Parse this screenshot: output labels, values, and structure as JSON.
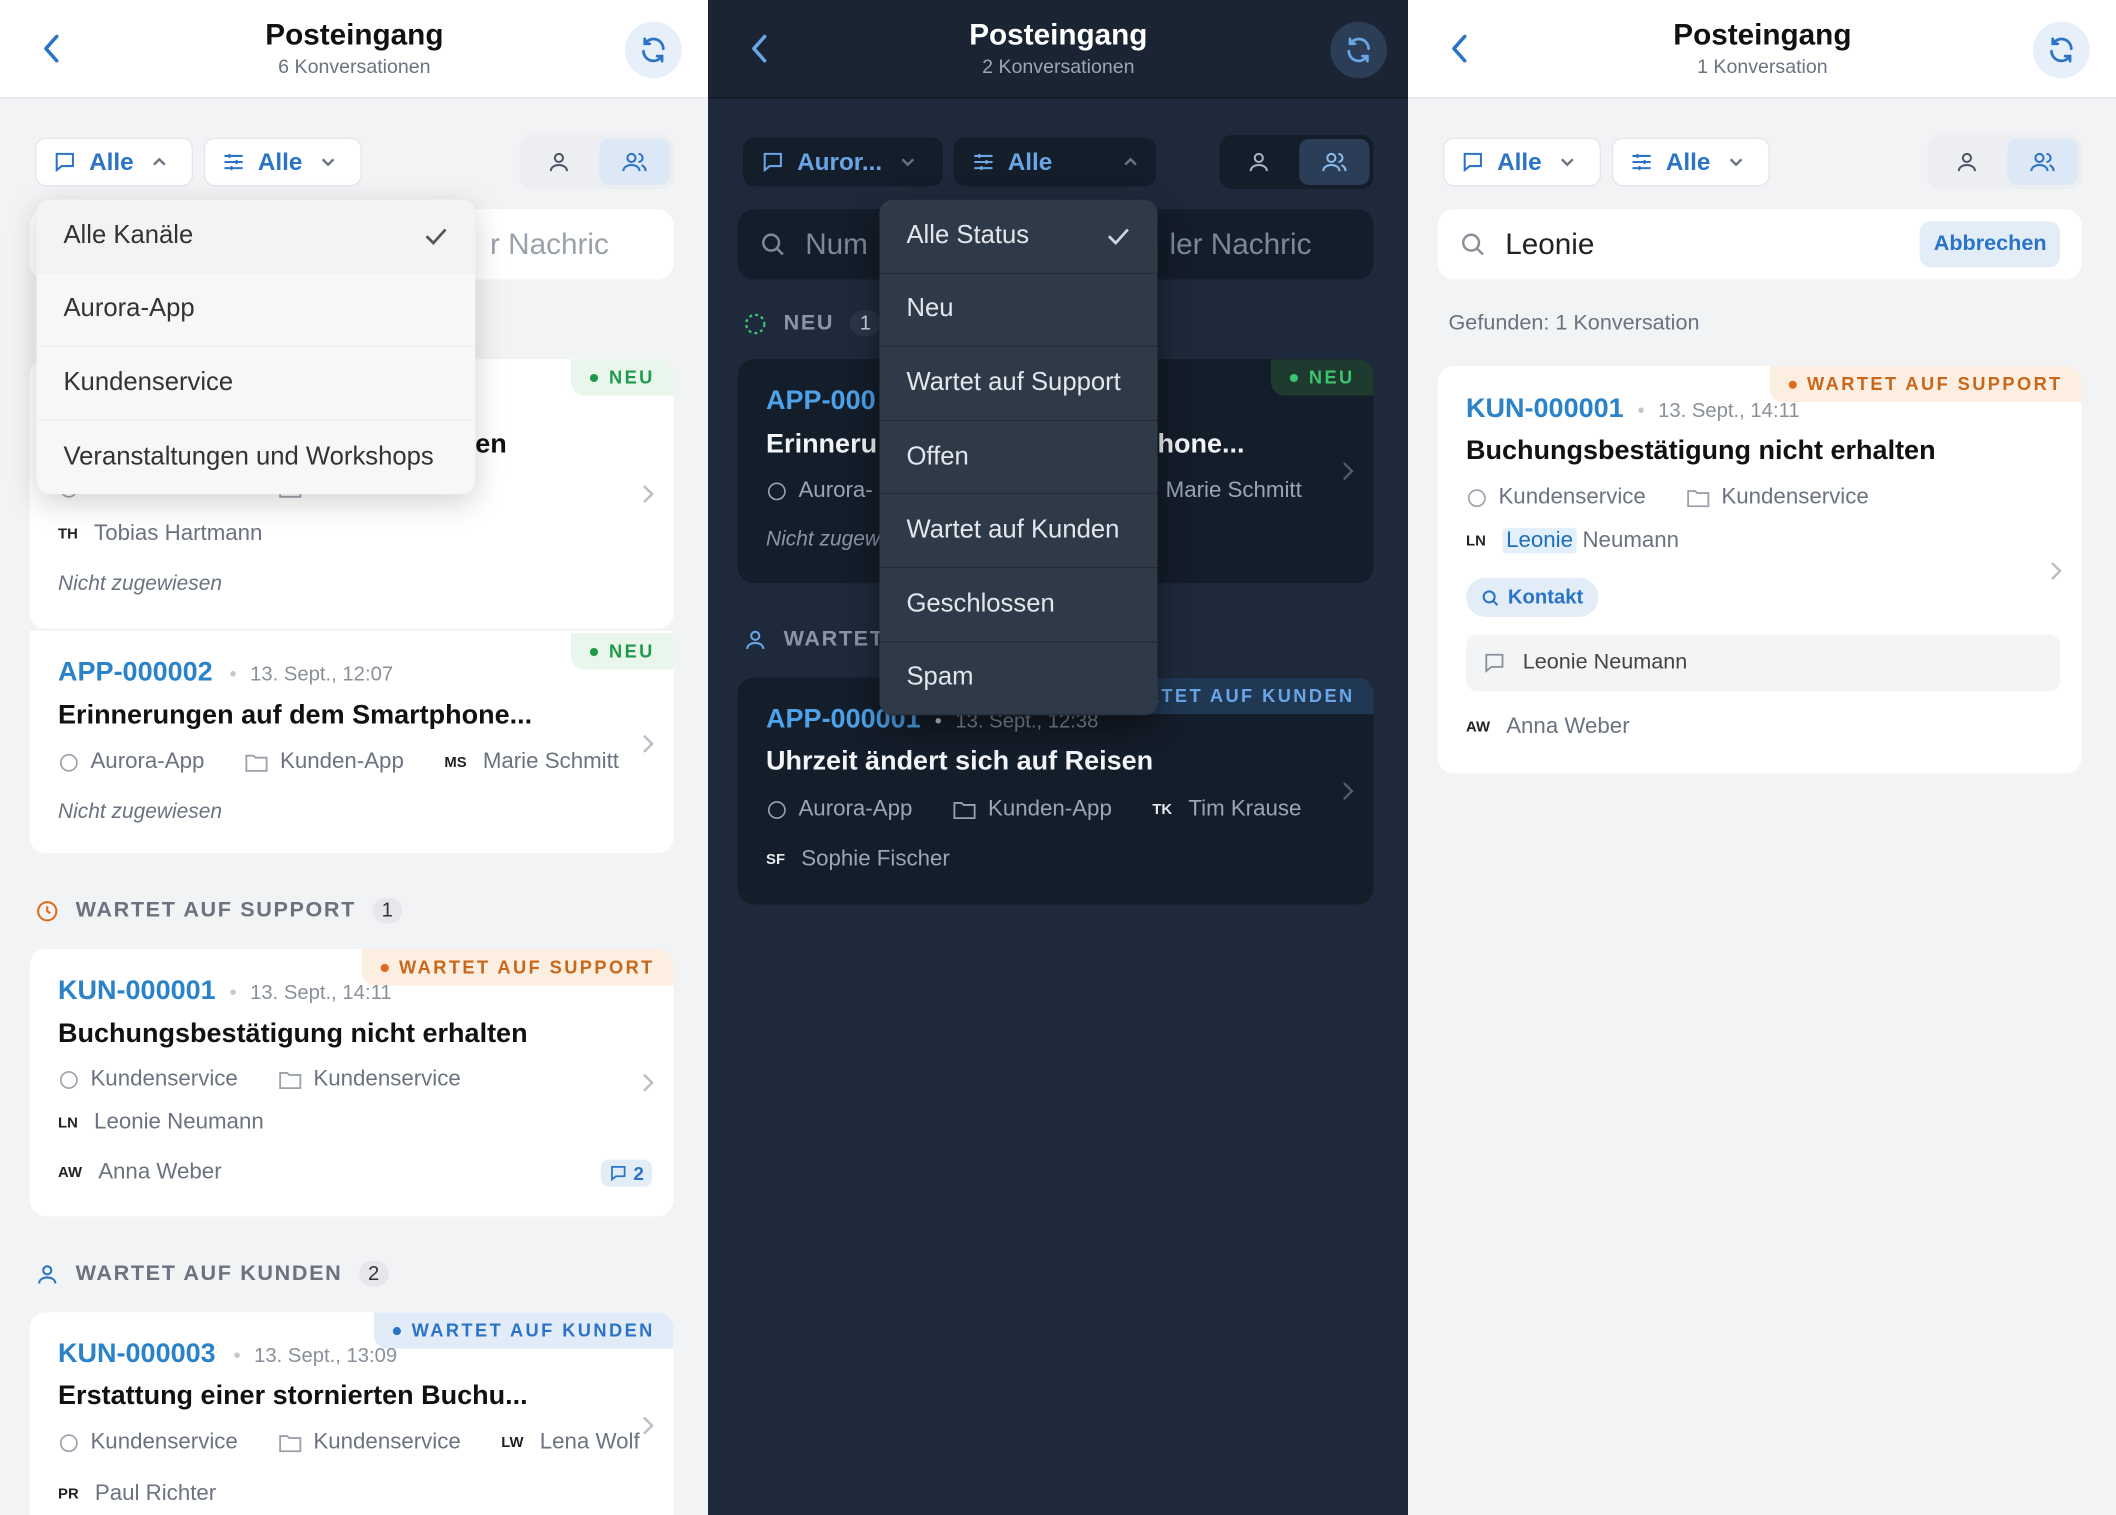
{
  "panel1": {
    "title": "Posteingang",
    "subtitle": "6 Konversationen",
    "filter_channel": "Alle",
    "filter_status": "Alle",
    "search_placeholder_visible": "r Nachric",
    "channel_dropdown": [
      {
        "label": "Alle Kanäle",
        "checked": true
      },
      {
        "label": "Aurora-App"
      },
      {
        "label": "Kundenservice"
      },
      {
        "label": "Veranstaltungen und Workshops"
      }
    ],
    "card1": {
      "badge": "NEU",
      "title_tail": "en",
      "channel": "Kundenservice",
      "inbox": "Kundenservice",
      "contact_initials": "TH",
      "contact": "Tobias Hartmann",
      "assignee": "Nicht zugewiesen"
    },
    "card2": {
      "badge": "NEU",
      "id": "APP-000002",
      "date": "13. Sept., 12:07",
      "title": "Erinnerungen auf dem Smartphone...",
      "channel": "Aurora-App",
      "inbox": "Kunden-App",
      "contact_initials": "MS",
      "contact": "Marie Schmitt",
      "assignee": "Nicht zugewiesen"
    },
    "section_support": {
      "label": "WARTET AUF SUPPORT",
      "count": "1"
    },
    "card3": {
      "badge": "WARTET AUF SUPPORT",
      "id": "KUN-000001",
      "date": "13. Sept., 14:11",
      "title": "Buchungsbestätigung nicht erhalten",
      "channel": "Kundenservice",
      "inbox": "Kundenservice",
      "contact_initials": "LN",
      "contact": "Leonie Neumann",
      "agent_initials": "AW",
      "agent": "Anna Weber",
      "messages": "2"
    },
    "section_kunden": {
      "label": "WARTET AUF KUNDEN",
      "count": "2"
    },
    "card4": {
      "badge": "WARTET AUF KUNDEN",
      "id": "KUN-000003",
      "date": "13. Sept., 13:09",
      "title": "Erstattung einer stornierten Buchu...",
      "channel": "Kundenservice",
      "inbox": "Kundenservice",
      "contact_initials": "LW",
      "contact": "Lena Wolf",
      "agent_initials": "PR",
      "agent": "Paul Richter"
    }
  },
  "panel2": {
    "title": "Posteingang",
    "subtitle": "2 Konversationen",
    "filter_channel": "Auror...",
    "filter_status": "Alle",
    "search_left": "Num",
    "search_right": "ler Nachric",
    "section_neu": {
      "label": "NEU",
      "count": "1"
    },
    "status_dropdown": [
      {
        "label": "Alle Status",
        "checked": true
      },
      {
        "label": "Neu"
      },
      {
        "label": "Wartet auf Support"
      },
      {
        "label": "Offen"
      },
      {
        "label": "Wartet auf Kunden"
      },
      {
        "label": "Geschlossen"
      },
      {
        "label": "Spam"
      }
    ],
    "card1": {
      "badge": "NEU",
      "id": "APP-000",
      "title_head": "Erinneru",
      "title_tail": "hone...",
      "channel": "Aurora-",
      "contact": "Marie Schmitt",
      "assignee": "Nicht zugew"
    },
    "section_wartet": {
      "label": "WARTET"
    },
    "card2": {
      "badge": "RTET AUF KUNDEN",
      "id": "APP-000001",
      "date": "13. Sept., 12:38",
      "title": "Uhrzeit ändert sich auf Reisen",
      "channel": "Aurora-App",
      "inbox": "Kunden-App",
      "contact_initials": "TK",
      "contact": "Tim Krause",
      "agent_initials": "SF",
      "agent": "Sophie Fischer"
    }
  },
  "panel3": {
    "title": "Posteingang",
    "subtitle": "1 Konversation",
    "filter_channel": "Alle",
    "filter_status": "Alle",
    "search_value": "Leonie",
    "cancel": "Abbrechen",
    "found": "Gefunden: 1 Konversation",
    "card": {
      "badge": "WARTET AUF SUPPORT",
      "id": "KUN-000001",
      "date": "13. Sept., 14:11",
      "title": "Buchungsbestätigung nicht erhalten",
      "channel": "Kundenservice",
      "inbox": "Kundenservice",
      "contact_initials": "LN",
      "contact_first": "Leonie",
      "contact_last": "Neumann",
      "chip": "Kontakt",
      "snippet": "Leonie Neumann",
      "agent_initials": "AW",
      "agent": "Anna Weber"
    }
  }
}
